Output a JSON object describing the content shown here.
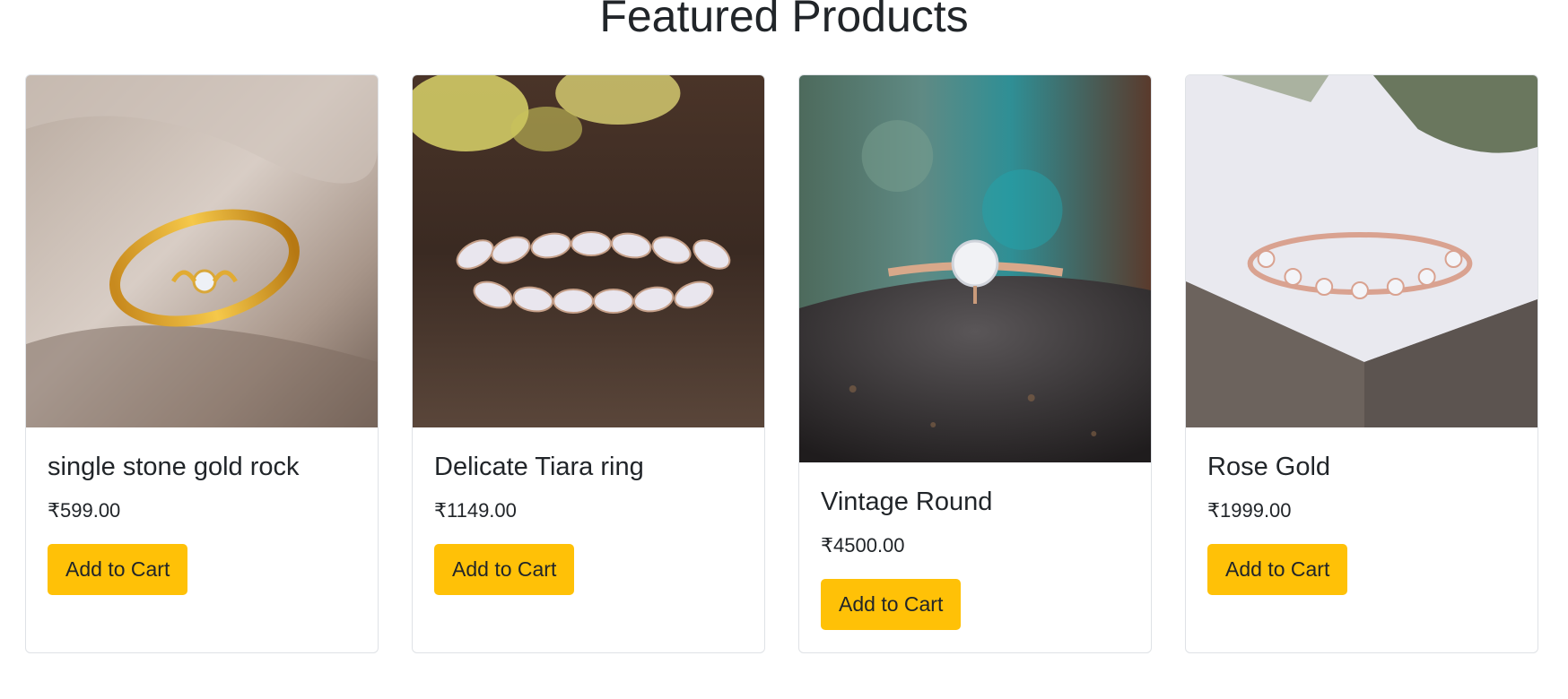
{
  "section": {
    "title": "Featured Products"
  },
  "products": [
    {
      "name": "single stone gold rock",
      "price": "₹599.00",
      "button": "Add to Cart",
      "image_icon": "gold-ring-single-stone-image"
    },
    {
      "name": "Delicate Tiara ring",
      "price": "₹1149.00",
      "button": "Add to Cart",
      "image_icon": "tiara-ring-image"
    },
    {
      "name": "Vintage Round",
      "price": "₹4500.00",
      "button": "Add to Cart",
      "image_icon": "vintage-round-ring-image"
    },
    {
      "name": "Rose Gold",
      "price": "₹1999.00",
      "button": "Add to Cart",
      "image_icon": "rose-gold-band-image"
    }
  ],
  "colors": {
    "button_bg": "#ffc107",
    "text": "#212529",
    "card_border": "#dfe2e6"
  }
}
